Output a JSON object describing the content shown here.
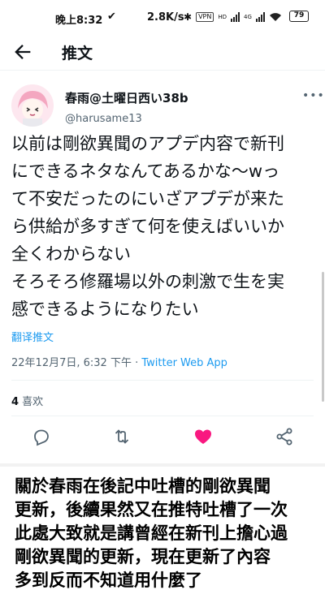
{
  "status_bar": {
    "time": "晚上8:32",
    "check_glyph": "✔",
    "speed": "2.8K/s",
    "bt_glyph": "✱",
    "vpn_label": "VPN",
    "hd_label": "HD",
    "net_label": "4G",
    "battery": "79"
  },
  "header": {
    "title": "推文"
  },
  "tweet": {
    "display_name": "春雨@土曜日西い38b",
    "handle": "@harusame13",
    "more_glyph": "•••",
    "lines": [
      "以前は剛欲異聞のアプデ内容で新刊",
      "にできるネタなんてあるかな〜wっ",
      "て不安だったのにいざアプデが来た",
      "ら供給が多すぎて何を使えばいいか",
      "全くわからない",
      "そろそろ修羅場以外の刺激で生を実",
      "感できるようになりたい"
    ],
    "translate": "翻译推文",
    "timestamp": "22年12月7日, 6:32 下午 · ",
    "client": "Twitter Web App",
    "like_count": "4",
    "like_label": " 喜欢"
  },
  "caption": {
    "lines": [
      "關於春雨在後記中吐槽的剛欲異聞",
      "更新，後續果然又在推特吐槽了一次",
      "此處大致就是講曾經在新刊上擔心過",
      "剛欲異聞的更新，現在更新了內容",
      "多到反而不知道用什麼了"
    ]
  },
  "colors": {
    "like_active": "#f91880",
    "link": "#1d9bf0",
    "secondary_text": "#536471"
  }
}
